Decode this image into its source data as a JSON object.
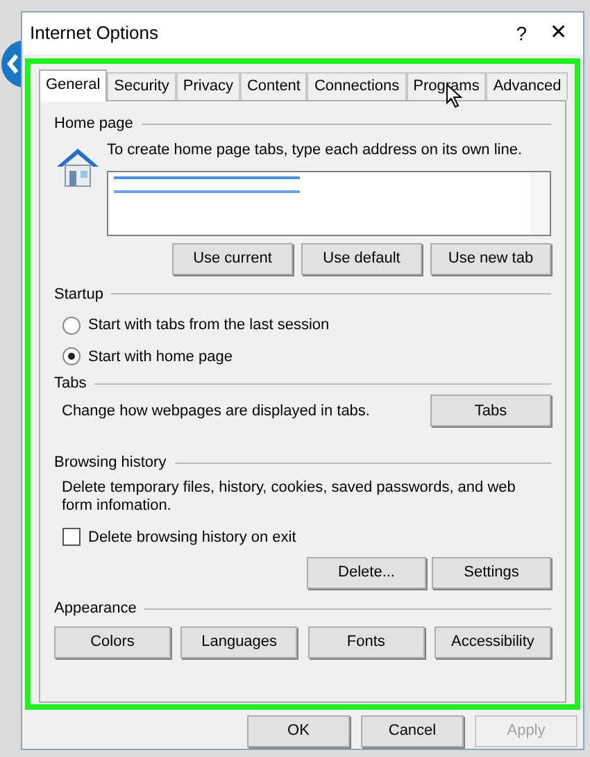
{
  "window": {
    "title": "Internet Options",
    "help": "?",
    "close": "✕"
  },
  "tabs": [
    {
      "label": "General",
      "selected": true
    },
    {
      "label": "Security",
      "selected": false
    },
    {
      "label": "Privacy",
      "selected": false
    },
    {
      "label": "Content",
      "selected": false
    },
    {
      "label": "Connections",
      "selected": false
    },
    {
      "label": "Programs",
      "selected": false
    },
    {
      "label": "Advanced",
      "selected": false
    }
  ],
  "home_page": {
    "label": "Home page",
    "hint": "To create home page tabs, type each address on its own line.",
    "buttons": [
      "Use current",
      "Use default",
      "Use new tab"
    ]
  },
  "startup": {
    "label": "Startup",
    "options": [
      {
        "label": "Start with tabs from the last session",
        "selected": false
      },
      {
        "label": "Start with home page",
        "selected": true
      }
    ]
  },
  "tabs_section": {
    "label": "Tabs",
    "text": "Change how webpages are displayed in tabs.",
    "button": "Tabs"
  },
  "browsing_history": {
    "label": "Browsing history",
    "text": "Delete temporary files, history, cookies, saved passwords, and web form infomation.",
    "checkbox": {
      "label": "Delete browsing history on exit",
      "checked": false
    },
    "buttons": [
      "Delete...",
      "Settings"
    ]
  },
  "appearance": {
    "label": "Appearance",
    "buttons": [
      "Colors",
      "Languages",
      "Fonts",
      "Accessibility"
    ]
  },
  "footer": [
    {
      "label": "OK",
      "disabled": false
    },
    {
      "label": "Cancel",
      "disabled": false
    },
    {
      "label": "Apply",
      "disabled": true
    }
  ]
}
